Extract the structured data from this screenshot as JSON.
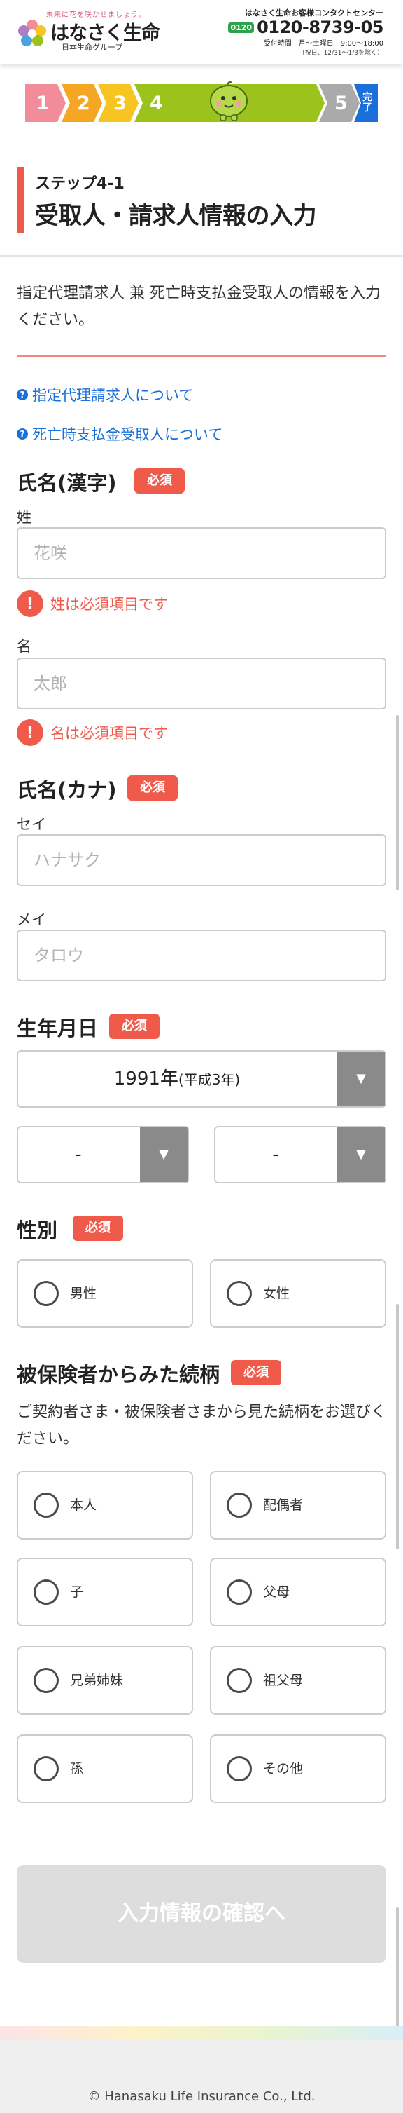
{
  "header": {
    "tagline": "未来に花を咲かせましょう。",
    "brand": "はなさく生命",
    "group": "日本生命グループ",
    "contact_title": "はなさく生命お客様コンタクトセンター",
    "freedial_icon": "freedial-icon",
    "phone": "0120-8739-05",
    "hours": "受付時間　月～土曜日　9:00～18:00",
    "hours_note": "（祝日、12/31～1/3を除く）"
  },
  "progress": {
    "steps": [
      "1",
      "2",
      "3",
      "4",
      "5",
      "完了"
    ],
    "current_step": 4,
    "colors": [
      "#f28c9a",
      "#f5a623",
      "#f6c521",
      "#9bc31c",
      "#aaaaaa",
      "#1a6fd9"
    ]
  },
  "page": {
    "subtitle": "ステップ4-1",
    "title": "受取人・請求人情報の入力",
    "intro": "指定代理請求人 兼 死亡時支払金受取人の情報を入力ください。"
  },
  "links": {
    "agent": "指定代理請求人について",
    "beneficiary": "死亡時支払金受取人について"
  },
  "required_label": "必須",
  "name_kanji": {
    "heading": "氏名(漢字)",
    "last_label": "姓",
    "last_placeholder": "花咲",
    "last_error": "姓は必須項目です",
    "first_label": "名",
    "first_placeholder": "太郎",
    "first_error": "名は必須項目です"
  },
  "name_kana": {
    "heading": "氏名(カナ)",
    "last_label": "セイ",
    "last_placeholder": "ハナサク",
    "first_label": "メイ",
    "first_placeholder": "タロウ"
  },
  "birthdate": {
    "heading": "生年月日",
    "year_value": "1991年",
    "year_era": "(平成3年)",
    "month_value": "-",
    "day_value": "-",
    "dropdown_icon": "chevron-down-icon"
  },
  "gender": {
    "heading": "性別",
    "options": [
      "男性",
      "女性"
    ]
  },
  "relationship": {
    "heading": "被保険者からみた続柄",
    "description": "ご契約者さま・被保険者さまから見た続柄をお選びください。",
    "options": [
      "本人",
      "配偶者",
      "子",
      "父母",
      "兄弟姉妹",
      "祖父母",
      "孫",
      "その他"
    ]
  },
  "submit_label": "入力情報の確認へ",
  "footer": {
    "copyright": "© Hanasaku Life Insurance Co., Ltd."
  },
  "colors": {
    "accent_red": "#f05a4a",
    "link_blue": "#1a6fd9",
    "disabled_gray": "#dddddd"
  }
}
